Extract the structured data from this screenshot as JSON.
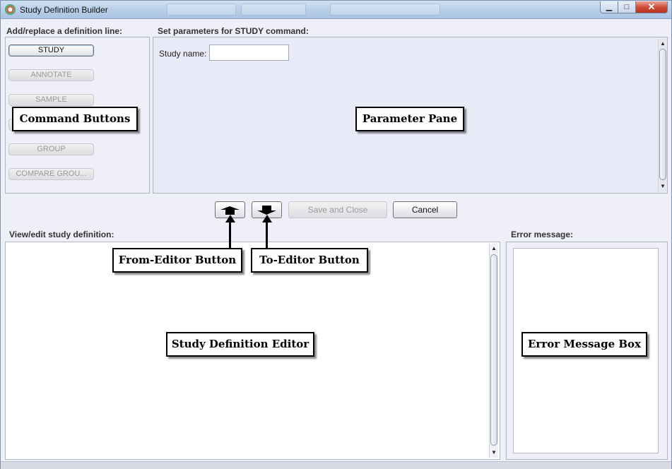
{
  "window": {
    "title": "Study Definition Builder",
    "minimize_glyph": "▁",
    "maximize_glyph": "□",
    "close_glyph": "✕"
  },
  "commands": {
    "section_label": "Add/replace a definition line:",
    "buttons": [
      {
        "label": "STUDY",
        "enabled": true
      },
      {
        "label": "ANNOTATE",
        "enabled": false
      },
      {
        "label": "SAMPLE",
        "enabled": false
      },
      {
        "label": "",
        "enabled": false
      },
      {
        "label": "GROUP",
        "enabled": false
      },
      {
        "label": "COMPARE GROU...",
        "enabled": false
      }
    ]
  },
  "parameters": {
    "section_label": "Set parameters for STUDY command:",
    "study_name_label": "Study name:",
    "study_name_value": ""
  },
  "actions": {
    "from_editor_icon": "arrow-up-icon",
    "to_editor_icon": "arrow-down-icon",
    "save_close": "Save and Close",
    "cancel": "Cancel"
  },
  "editor": {
    "section_label": "View/edit study definition:",
    "content": ""
  },
  "error": {
    "section_label": "Error message:",
    "content": ""
  },
  "callouts": {
    "command_buttons": "Command Buttons",
    "parameter_pane": "Parameter Pane",
    "from_editor": "From-Editor Button",
    "to_editor": "To-Editor Button",
    "editor": "Study Definition Editor",
    "error_box": "Error Message Box"
  }
}
